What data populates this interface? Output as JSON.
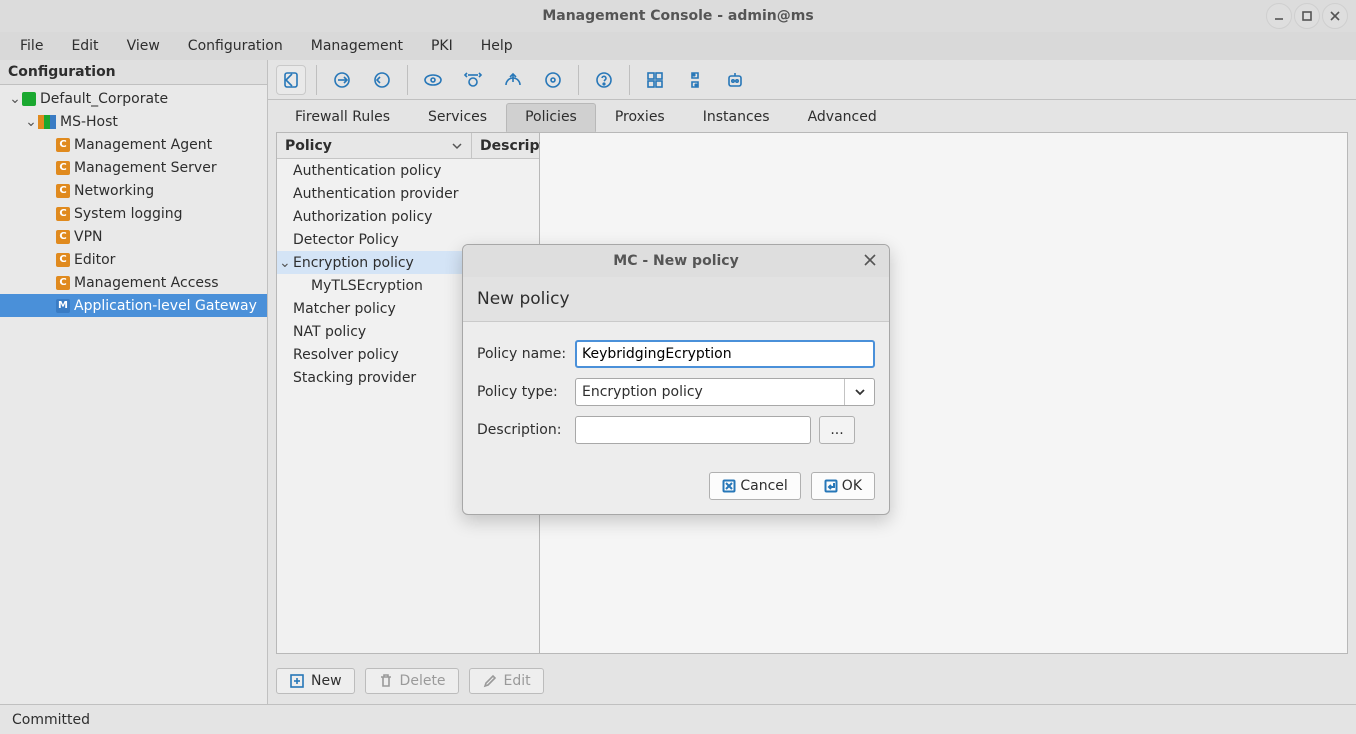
{
  "window": {
    "title": "Management Console - admin@ms"
  },
  "menu": [
    "File",
    "Edit",
    "View",
    "Configuration",
    "Management",
    "PKI",
    "Help"
  ],
  "sidebar": {
    "title": "Configuration",
    "tree": {
      "site": "Default_Corporate",
      "host": "MS-Host",
      "children": [
        "Management Agent",
        "Management Server",
        "Networking",
        "System logging",
        "VPN",
        "Editor",
        "Management Access",
        "Application-level Gateway"
      ]
    }
  },
  "tabs": [
    "Firewall Rules",
    "Services",
    "Policies",
    "Proxies",
    "Instances",
    "Advanced"
  ],
  "policy_columns": {
    "col1": "Policy",
    "col2": "Description"
  },
  "policies": [
    "Authentication policy",
    "Authentication provider",
    "Authorization policy",
    "Detector Policy",
    "Encryption policy",
    "Matcher policy",
    "NAT policy",
    "Resolver policy",
    "Stacking provider"
  ],
  "encryption_children": [
    "MyTLSEcryption"
  ],
  "actions": {
    "new": "New",
    "delete": "Delete",
    "edit": "Edit"
  },
  "status": "Committed",
  "dialog": {
    "title": "MC - New policy",
    "header": "New policy",
    "labels": {
      "name": "Policy name:",
      "type": "Policy type:",
      "desc": "Description:"
    },
    "name_value": "KeybridgingEcryption",
    "type_value": "Encryption policy",
    "desc_value": "",
    "ellipsis": "...",
    "cancel": "Cancel",
    "ok": "OK"
  }
}
